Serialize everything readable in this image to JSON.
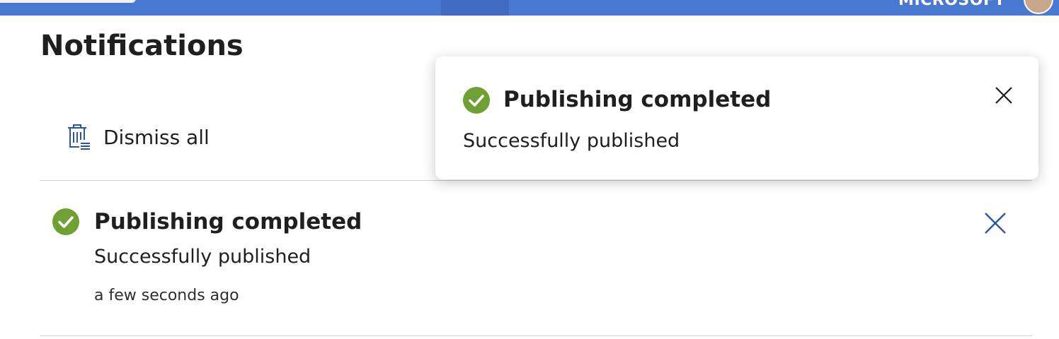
{
  "topbar": {
    "account_label": "MICROSOFT",
    "color": "#4878d0"
  },
  "page": {
    "title": "Notifications"
  },
  "actions": {
    "dismiss_all_label": "Dismiss all",
    "dismiss_all_icon": "trash-list-icon"
  },
  "notifications": [
    {
      "title": "Publishing completed",
      "message": "Successfully published",
      "time": "a few seconds ago",
      "status": "success",
      "status_color": "#6fa132",
      "status_icon": "check-circle-icon",
      "close_icon": "close-icon"
    }
  ],
  "toast": {
    "title": "Publishing completed",
    "message": "Successfully published",
    "status": "success",
    "status_color": "#6fa132",
    "status_icon": "check-circle-icon",
    "close_icon": "close-icon"
  },
  "colors": {
    "accent": "#2b579a",
    "success": "#6fa132"
  }
}
